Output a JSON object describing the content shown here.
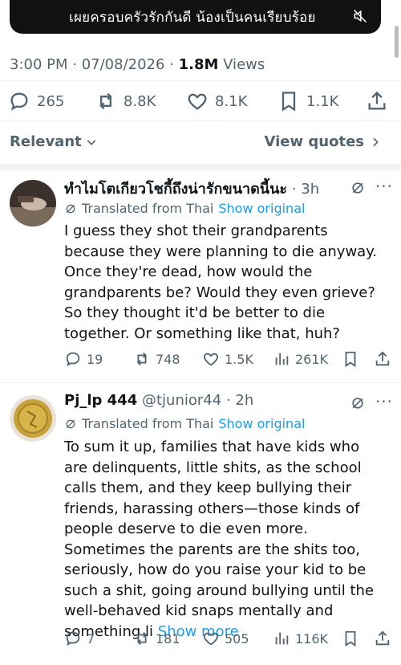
{
  "media": {
    "caption": "เผยครอบครัวรักกันดี น้องเป็นคนเรียบร้อย"
  },
  "tweet_meta": {
    "time": "3:00 PM · 07/08/2026 · ",
    "views_count": "1.8M",
    "views_label": " Views"
  },
  "tweet_actions": {
    "replies": "265",
    "reposts": "8.8K",
    "likes": "8.1K",
    "bookmarks": "1.1K"
  },
  "sort": {
    "label": "Relevant",
    "view_quotes": "View quotes"
  },
  "replies": [
    {
      "name": "ทำไมโตเกียวโชกี้ถึงน่ารักขนาดนี้นะ",
      "time": "· 3h",
      "translated_label": "Translated from Thai",
      "show_original": "Show original",
      "body": "I guess they shot their grandparents because they were planning to die anyway. Once they're dead, how would the grandparents be? Would they even grieve? So they thought it'd be better to die together. Or something like that, huh?",
      "replies": "19",
      "reposts": "748",
      "likes": "1.5K",
      "views": "261K"
    },
    {
      "name": "Pj_lp 444",
      "handle": "@tjunior44",
      "time": "· 2h",
      "translated_label": "Translated from Thai",
      "show_original": "Show original",
      "body": "To sum it up, families that have kids who are delinquents, little shits, as the school calls them, and they keep bullying their friends, harassing others—those kinds of people deserve to die even more. Sometimes the parents are the shits too, seriously, how do you raise your kid to be such a shit, going around bullying until the well-behaved kid snaps mentally and something li",
      "show_more": "Show more",
      "replies": "7",
      "reposts": "181",
      "likes": "505",
      "views": "116K"
    }
  ]
}
